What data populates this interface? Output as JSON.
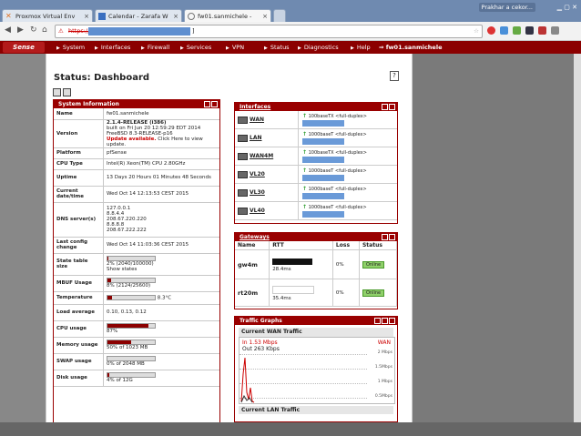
{
  "browser": {
    "profile_name": "Prakhar a cekor...",
    "tabs": [
      {
        "label": "Proxmox Virtual Env",
        "icon": "proxmox-x-icon",
        "color": "#e07020"
      },
      {
        "label": "Calendar - Zarafa W",
        "icon": "calendar-icon",
        "color": "#3a6fc0"
      },
      {
        "label": "fw01.sanmichele - ",
        "icon": "pfsense-tab-icon",
        "color": "#777777"
      }
    ],
    "address_scheme": "https://",
    "address_suffix": "]"
  },
  "nav": {
    "logo": "Sense",
    "menu": [
      "System",
      "Interfaces",
      "Firewall",
      "Services",
      "VPN",
      "Status",
      "Diagnostics",
      "Help"
    ],
    "hostname": "fw01.sanmichele"
  },
  "page": {
    "title": "Status: Dashboard",
    "help": "?"
  },
  "system_info": {
    "title": "System Information",
    "rows": [
      {
        "key": "Name",
        "value": "fw01.sanmichele"
      },
      {
        "key": "Version",
        "value": "2.1.4-RELEASE (i386)",
        "extra": "built on Fri Jun 20 12:59:29 EDT 2014",
        "extra2": "FreeBSD 8.3-RELEASE-p16",
        "update": "Update available.",
        "update_rest": "Click Here to view update."
      },
      {
        "key": "Platform",
        "value": "pfSense"
      },
      {
        "key": "CPU Type",
        "value": "Intel(R) Xeon(TM) CPU 2.80GHz"
      },
      {
        "key": "Uptime",
        "value": "13 Days 20 Hours 01 Minutes 48 Seconds"
      },
      {
        "key": "Current date/time",
        "value": "Wed Oct 14 12:13:53 CEST 2015"
      },
      {
        "key": "DNS server(s)",
        "value": "127.0.0.1",
        "lines": [
          "8.8.4.4",
          "208.67.220.220",
          "8.8.8.8",
          "208.67.222.222"
        ]
      },
      {
        "key": "Last config change",
        "value": "Wed Oct 14 11:03:36 CEST 2015"
      },
      {
        "key": "State table size",
        "value": "2% (2040/100000)",
        "extra": "Show states",
        "bar": 0.02
      },
      {
        "key": "MBUF Usage",
        "value": "8% (2124/25600)",
        "bar": 0.08
      },
      {
        "key": "Temperature",
        "value": "8.3°C",
        "bar": 0.1
      },
      {
        "key": "Load average",
        "value": "0.10, 0.13, 0.12"
      },
      {
        "key": "CPU usage",
        "value": "87%",
        "bar": 0.87
      },
      {
        "key": "Memory usage",
        "value": "50% of 1023 MB",
        "bar": 0.5
      },
      {
        "key": "SWAP usage",
        "value": "0% of 2048 MB",
        "bar": 0.0
      },
      {
        "key": "Disk usage",
        "value": "4% of 12G",
        "bar": 0.04
      }
    ]
  },
  "interfaces": {
    "title": "Interfaces",
    "rows": [
      {
        "name": "WAN",
        "status": "100baseTX <full-duplex>"
      },
      {
        "name": "LAN",
        "status": "1000baseT <full-duplex>"
      },
      {
        "name": "WAN4M",
        "status": "100baseTX <full-duplex>"
      },
      {
        "name": "VL20",
        "status": "1000baseT <full-duplex>"
      },
      {
        "name": "VL30",
        "status": "1000baseT <full-duplex>"
      },
      {
        "name": "VL40",
        "status": "1000baseT <full-duplex>"
      }
    ]
  },
  "gateways": {
    "title": "Gateways",
    "headers": [
      "Name",
      "RTT",
      "Loss",
      "Status"
    ],
    "rows": [
      {
        "name": "gw4m",
        "rtt": "28.4ms",
        "loss": "0%",
        "status": "Online"
      },
      {
        "name": "rt20m",
        "rtt": "35.4ms",
        "loss": "0%",
        "status": "Online"
      }
    ]
  },
  "traffic": {
    "title": "Traffic Graphs",
    "graph1_title": "Current WAN Traffic",
    "graph1_in": "In 1.53 Mbps",
    "graph1_out": "Out 263 Kbps",
    "graph1_label": "WAN",
    "y_labels": [
      "2 Mbps",
      "1.5Mbps",
      "1 Mbps",
      "0.5Mbps"
    ],
    "graph2_title": "Current LAN Traffic"
  }
}
